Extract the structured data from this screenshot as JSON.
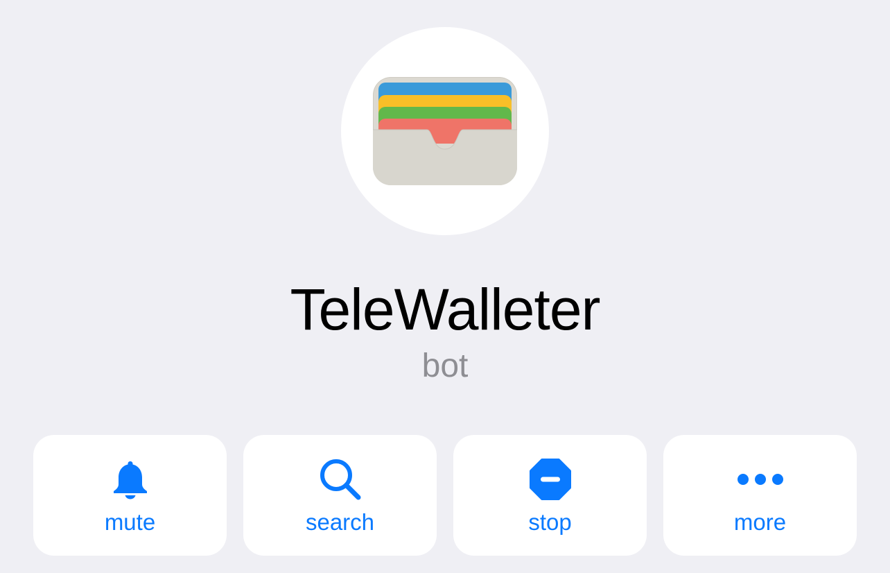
{
  "profile": {
    "name": "TeleWalleter",
    "subtitle": "bot",
    "avatar_icon": "wallet-icon"
  },
  "actions": [
    {
      "label": "mute",
      "icon": "bell-icon"
    },
    {
      "label": "search",
      "icon": "magnifier-icon"
    },
    {
      "label": "stop",
      "icon": "stop-icon"
    },
    {
      "label": "more",
      "icon": "ellipsis-icon"
    }
  ],
  "colors": {
    "background": "#efeff4",
    "card": "#ffffff",
    "accent": "#0a7aff",
    "title": "#000000",
    "subtitle": "#8e8e93"
  }
}
